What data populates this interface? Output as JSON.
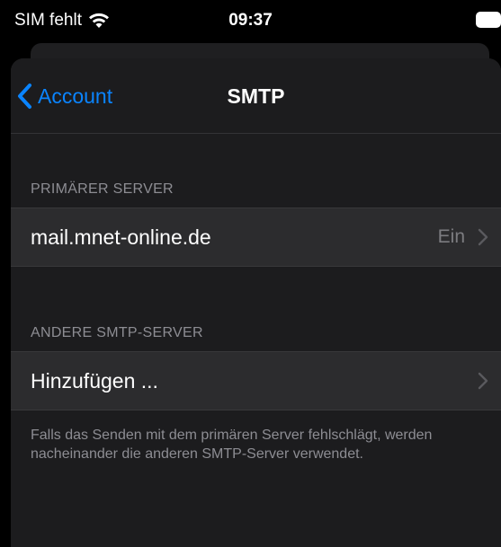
{
  "status_bar": {
    "carrier": "SIM fehlt",
    "time": "09:37",
    "wifi_icon": "wifi-icon",
    "battery_icon": "battery-full-icon"
  },
  "nav": {
    "back_label": "Account",
    "title": "SMTP",
    "back_icon": "chevron-left-icon",
    "accent_color": "#0a84ff"
  },
  "primary_section": {
    "header": "PRIMÄRER SERVER",
    "server": {
      "label": "mail.mnet-online.de",
      "value": "Ein"
    }
  },
  "other_section": {
    "header": "ANDERE SMTP-SERVER",
    "add_label": "Hinzufügen ...",
    "footer": "Falls das Senden mit dem primären Server fehlschlägt, werden nacheinander die anderen SMTP-Server verwendet."
  }
}
